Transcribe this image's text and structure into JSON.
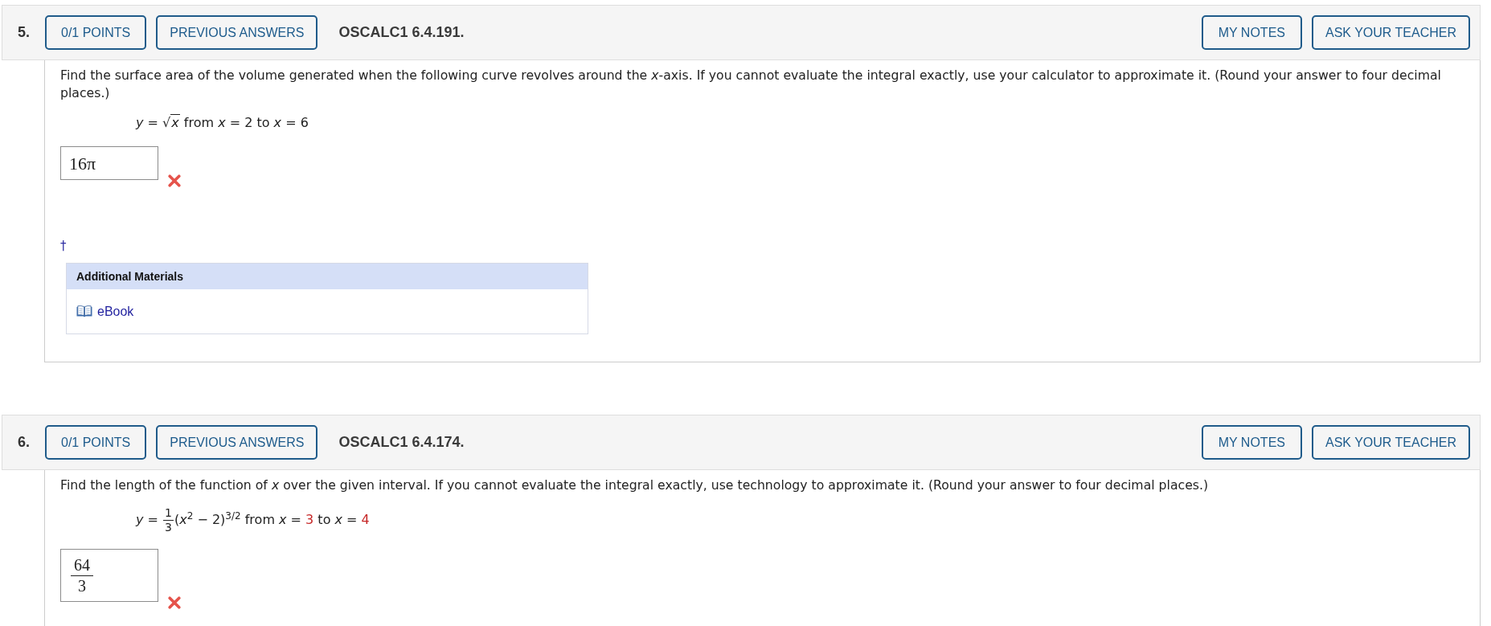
{
  "questions": [
    {
      "number": "5.",
      "points": "0/1 POINTS",
      "previous_answers": "PREVIOUS ANSWERS",
      "code": "OSCALC1 6.4.191.",
      "my_notes": "MY NOTES",
      "ask_teacher": "ASK YOUR TEACHER",
      "prompt": "Find the surface area of the volume generated when the following curve revolves around the *x*-axis. If you cannot evaluate the integral exactly, use your calculator to approximate it. (Round your answer to four decimal places.)",
      "formula": [
        {
          "kind": "text",
          "text": "*y* = "
        },
        {
          "kind": "root",
          "sign": "√",
          "radicand": "*x*"
        },
        {
          "kind": "text",
          "text": " from *x* = 2 to *x* = 6"
        }
      ],
      "answer": {
        "kind": "text",
        "value": "16π"
      },
      "correct": false,
      "footnote": "†",
      "additional_materials": {
        "title": "Additional Materials",
        "links": [
          "eBook"
        ]
      }
    },
    {
      "number": "6.",
      "points": "0/1 POINTS",
      "previous_answers": "PREVIOUS ANSWERS",
      "code": "OSCALC1 6.4.174.",
      "my_notes": "MY NOTES",
      "ask_teacher": "ASK YOUR TEACHER",
      "prompt": "Find the length of the function of *x* over the given interval. If you cannot evaluate the integral exactly, use technology to approximate it. (Round your answer to four decimal places.)",
      "formula": [
        {
          "kind": "text",
          "text": "*y* = "
        },
        {
          "kind": "fraction",
          "numerator": "1",
          "denominator": "3"
        },
        {
          "kind": "text",
          "text": "(*x*$^{2}$ − 2)$^{3/2}$ from *x* = "
        },
        {
          "kind": "param",
          "text": "3"
        },
        {
          "kind": "text",
          "text": " to *x* = "
        },
        {
          "kind": "param",
          "text": "4"
        }
      ],
      "answer": {
        "kind": "fraction",
        "numerator": "64",
        "denominator": "3"
      },
      "correct": false
    }
  ]
}
